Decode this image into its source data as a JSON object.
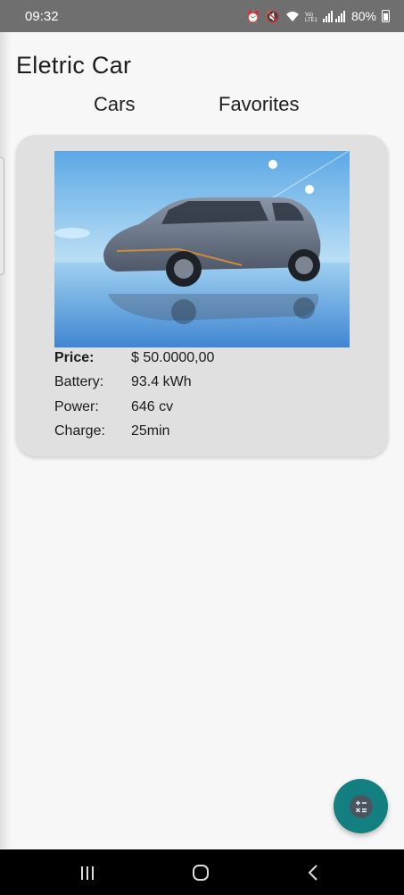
{
  "status_bar": {
    "time": "09:32",
    "battery": "80%",
    "icons": [
      "alarm-icon",
      "mute-icon",
      "wifi-icon",
      "volte-icon",
      "signal-icon",
      "battery-icon"
    ]
  },
  "app": {
    "title": "Eletric Car"
  },
  "tabs": [
    {
      "label": "Cars"
    },
    {
      "label": "Favorites"
    }
  ],
  "car": {
    "image_icon": "car-photo",
    "specs": [
      {
        "label": "Price:",
        "value": "$ 50.0000,00"
      },
      {
        "label": "Battery:",
        "value": "93.4 kWh"
      },
      {
        "label": "Power:",
        "value": "646 cv"
      },
      {
        "label": "Charge:",
        "value": "25min"
      }
    ]
  },
  "fab": {
    "icon": "calculator-icon"
  },
  "nav": {
    "icons": [
      "recent-apps-icon",
      "home-icon",
      "back-icon"
    ]
  },
  "colors": {
    "status_bar": "#6f6f6f",
    "background": "#f7f7f7",
    "card": "#e0e0e0",
    "fab": "#137f80"
  }
}
